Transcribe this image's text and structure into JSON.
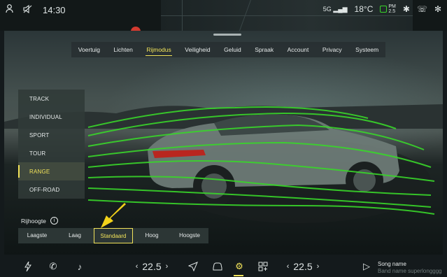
{
  "status": {
    "time": "14:30",
    "signal_label": "5G",
    "temperature": "18°C",
    "aqi_top": "PM",
    "aqi_value": "2.5"
  },
  "tabs": [
    {
      "label": "Voertuig"
    },
    {
      "label": "Lichten"
    },
    {
      "label": "Rijmodus",
      "active": true
    },
    {
      "label": "Veiligheid"
    },
    {
      "label": "Geluid"
    },
    {
      "label": "Spraak"
    },
    {
      "label": "Account"
    },
    {
      "label": "Privacy"
    },
    {
      "label": "Systeem"
    }
  ],
  "modes": [
    {
      "label": "TRACK"
    },
    {
      "label": "INDIVIDUAL"
    },
    {
      "label": "SPORT"
    },
    {
      "label": "TOUR"
    },
    {
      "label": "RANGE",
      "active": true
    },
    {
      "label": "OFF-ROAD"
    }
  ],
  "ride_height": {
    "title": "Rijhoogte",
    "options": [
      "Laagste",
      "Laag",
      "Standaard",
      "Hoog",
      "Hoogste"
    ],
    "selected": "Standaard"
  },
  "bottom": {
    "temp_left": "22.5",
    "temp_right": "22.5",
    "song_name": "Song name",
    "band_name": "Band name superlongggg"
  },
  "colors": {
    "accent": "#f2e35a",
    "flow": "#39d62a"
  }
}
